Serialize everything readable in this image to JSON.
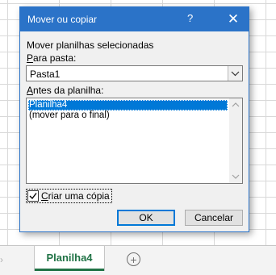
{
  "dialog": {
    "title": "Mover ou copiar",
    "help_label": "?",
    "close_label": "✕",
    "move_selected_label": "Mover planilhas selecionadas",
    "to_book_label_prefix": "P",
    "to_book_label_rest": "ara pasta:",
    "to_book_value": "Pasta1",
    "before_sheet_label_prefix": "A",
    "before_sheet_label_rest": "ntes da planilha:",
    "sheets": [
      {
        "label": "Planilha4",
        "selected": true
      },
      {
        "label": "(mover para o final)",
        "selected": false
      }
    ],
    "copy_label_prefix": "C",
    "copy_label_rest": "riar uma cópia",
    "copy_checked": true,
    "ok_label": "OK",
    "cancel_label": "Cancelar"
  },
  "sheet_bar": {
    "active_tab": "Planilha4",
    "nav_arrow": "›",
    "add_sheet_symbol": "+"
  },
  "colors": {
    "title_bar": "#2b73c8",
    "selection": "#0078d7",
    "sheet_tab_accent": "#217346"
  }
}
